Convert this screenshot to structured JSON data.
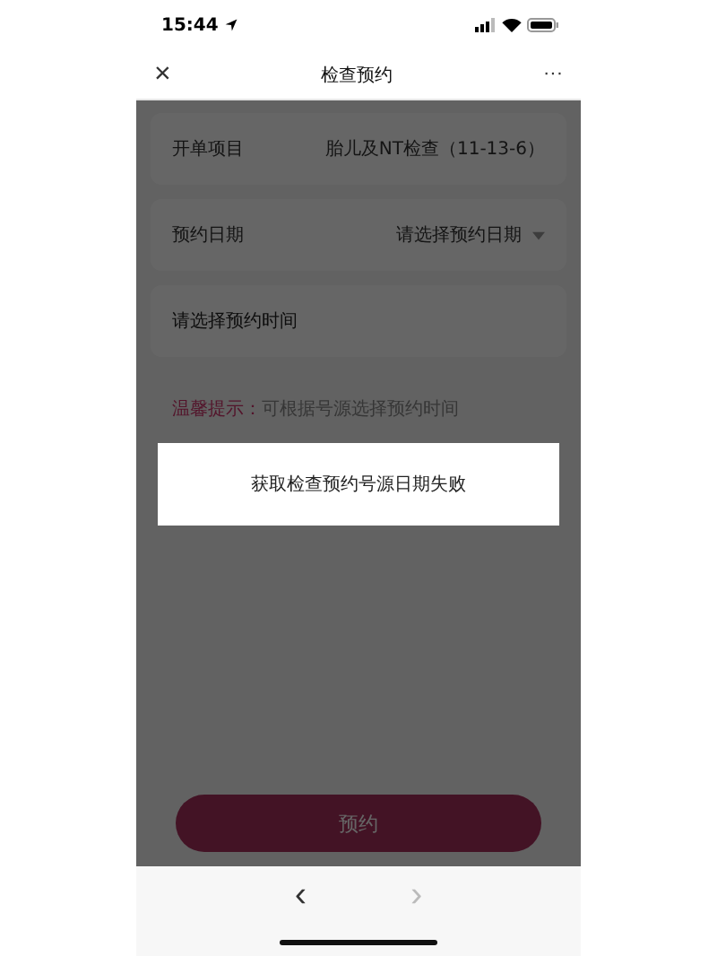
{
  "status_bar": {
    "time": "15:44"
  },
  "nav_bar": {
    "title": "检查预约",
    "close": "×",
    "more": "···"
  },
  "form": {
    "fields": [
      {
        "kind": "value",
        "label": "开单项目",
        "value": "胎儿及NT检查（11-13-6）"
      },
      {
        "kind": "select",
        "label": "预约日期",
        "placeholder": "请选择预约日期"
      },
      {
        "kind": "input",
        "placeholder": "请选择预约时间"
      }
    ],
    "tip": {
      "label": "温馨提示：",
      "text": "可根据号源选择预约时间"
    },
    "submit": {
      "label": "预约",
      "disabled": true
    }
  },
  "overlay": {
    "shown": true
  },
  "toast": {
    "message": "获取检查预约号源日期失败"
  },
  "browser_toolbar": {
    "back": {
      "label": "‹",
      "disabled": false
    },
    "forward": {
      "label": "›",
      "disabled": true
    }
  }
}
